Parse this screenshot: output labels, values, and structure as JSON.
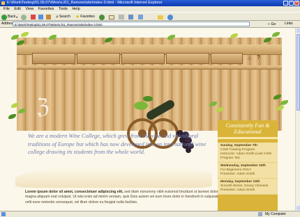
{
  "window": {
    "title": "E:\\Work\\Testing\\01.09.07\\Wine\\s.l01_Ramzes\\site\\index-3.html - Microsoft Internet Explorer",
    "controls": [
      "_",
      "□",
      "x"
    ]
  },
  "menu": [
    "File",
    "Edit",
    "View",
    "Favorites",
    "Tools",
    "Help"
  ],
  "toolbar": {
    "back_label": "Back",
    "search_label": "Search",
    "favorites_label": "Favorites"
  },
  "address": {
    "label": "Address",
    "value": "E:\\Work\\Testing\\01.09.07\\Wine\\s.l01_Ramzes\\site\\index-3.html",
    "go_label": "Go",
    "links_label": "Links"
  },
  "page": {
    "intro_text": "We are a modern Wine College, which grew from the vine and viticultural traditions of Europe but which has now developed into an international wine college drawing its students from the whole world.",
    "body_bold": "Lorem ipsum dolor sit amet, consectetuer adipiscing elit,",
    "body_text": " sed diam nonummy nibh euismod tincidunt ut laoreet dolore magna aliquam erat volutpat. Ut wisi enim ad minim veniam, quis Duis autem vel eum iriure dolor in hendrerit in vulputate velit esse molestie consequat, vel illum dolore eu feugiat nulla facilisis.",
    "nav_icons": [
      "home-icon",
      "help-icon"
    ],
    "sidebar": {
      "title": "Consistently Fun & Educational",
      "events": [
        {
          "date": "Sunday, September 7th",
          "line1": "CSW Training Program",
          "line2": "Instructor: Adam Smith (Last CSW Program '08)"
        },
        {
          "date": "Wednesday, September 10th",
          "line1": "For Beginners ONLY",
          "line2": "Presenter: Adam Smith"
        },
        {
          "date": "Monday, September 15th",
          "line1": "Smooth Wines, Gooey Cheeses",
          "line2": "Presenter: Adam Smith"
        }
      ]
    }
  },
  "status": {
    "zone": "My Computer"
  },
  "colors": {
    "accent_gold": "#d9b438",
    "intro_text": "#6e7ab0",
    "title_bar": "#0b3bb0"
  }
}
